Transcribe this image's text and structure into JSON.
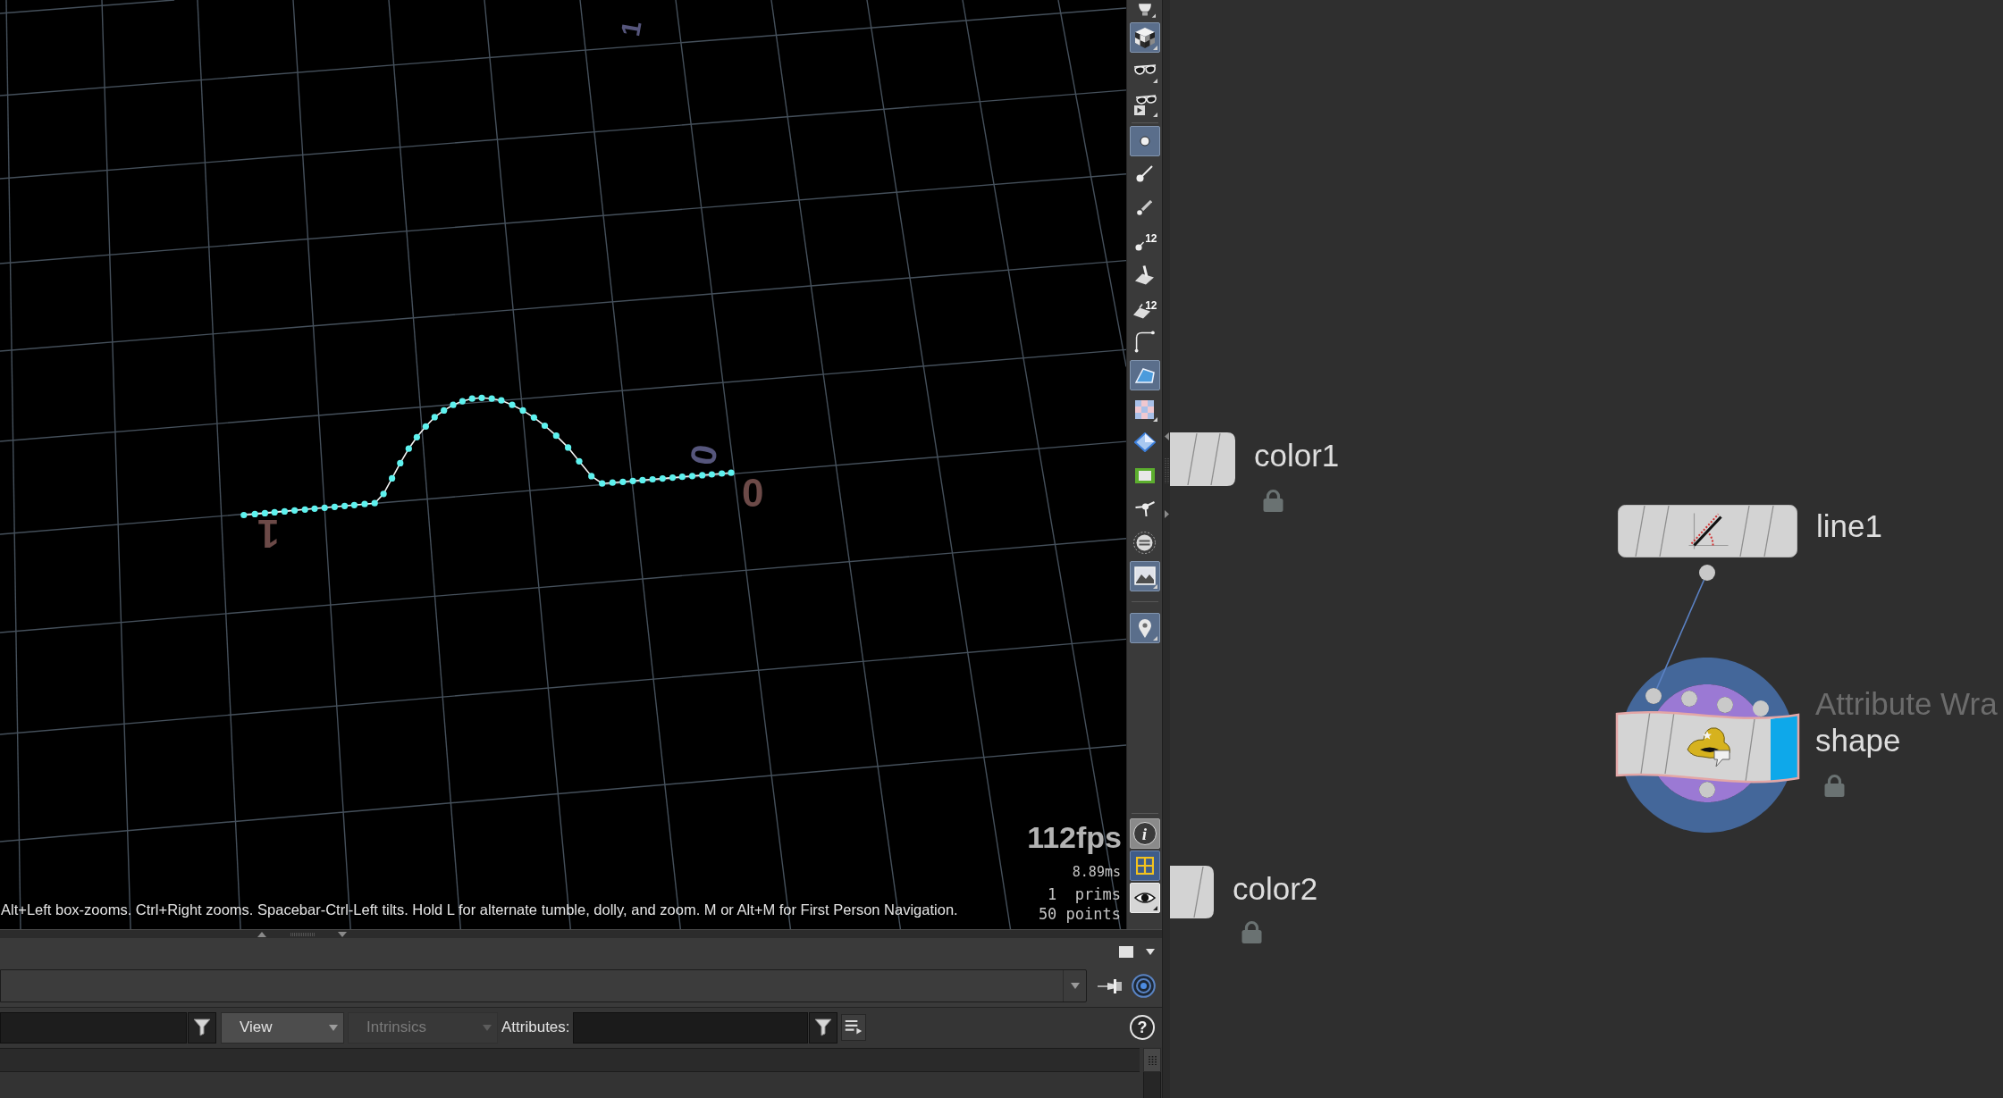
{
  "viewport": {
    "axis_labels": [
      {
        "text": "1",
        "color": "#56567c"
      },
      {
        "text": "0",
        "color": "#56567c"
      },
      {
        "text": "0",
        "color": "#6c4a48"
      },
      {
        "text": "1",
        "color": "#6c4a48"
      }
    ],
    "fps": "112fps",
    "frame_time": "8.89ms",
    "stats": [
      "1  prims",
      "50 points"
    ],
    "hint": "Alt+Left box-zooms. Ctrl+Right zooms. Spacebar-Ctrl-Left tilts. Hold L for alternate tumble, dolly, and zoom. M or Alt+M for First Person Navigation."
  },
  "toolbar": {
    "groups": [
      {
        "items": [
          {
            "kind": "lightbulb",
            "on": false
          },
          {
            "kind": "cube",
            "on": true
          },
          {
            "kind": "glasses",
            "on": false
          },
          {
            "kind": "glasses-play",
            "on": false
          }
        ]
      },
      {
        "items": [
          {
            "kind": "point",
            "on": true
          },
          {
            "kind": "brush",
            "on": false
          },
          {
            "kind": "pen",
            "on": false
          },
          {
            "kind": "point-number",
            "on": false,
            "badge": "12"
          },
          {
            "kind": "face",
            "on": false
          },
          {
            "kind": "face-number",
            "on": false,
            "badge": "12"
          },
          {
            "kind": "curve",
            "on": false
          },
          {
            "kind": "polygon",
            "on": true
          },
          {
            "kind": "checker",
            "on": false
          },
          {
            "kind": "diamond",
            "on": false
          },
          {
            "kind": "uv",
            "on": false
          },
          {
            "kind": "axes",
            "on": false
          },
          {
            "kind": "disc",
            "on": false
          },
          {
            "kind": "image",
            "on": true
          }
        ]
      },
      {
        "items": [
          {
            "kind": "pin",
            "on": true
          }
        ]
      }
    ],
    "bottom": [
      {
        "kind": "info",
        "label": "i"
      },
      {
        "kind": "viewports"
      },
      {
        "kind": "eye"
      }
    ]
  },
  "spreadsheet": {
    "view": {
      "value": "View",
      "disabled": false
    },
    "intrinsics": {
      "value": "Intrinsics",
      "disabled": true
    },
    "attributes_label": "Attributes:",
    "help": "?"
  },
  "network": {
    "nodes": [
      {
        "kind": "color",
        "name": "color1",
        "locked": true
      },
      {
        "kind": "line",
        "name": "line1",
        "locked": false
      },
      {
        "kind": "attribwrangle",
        "type_label": "Attribute Wra",
        "name": "shape",
        "locked": true
      },
      {
        "kind": "color",
        "name": "color2",
        "locked": true
      }
    ]
  }
}
